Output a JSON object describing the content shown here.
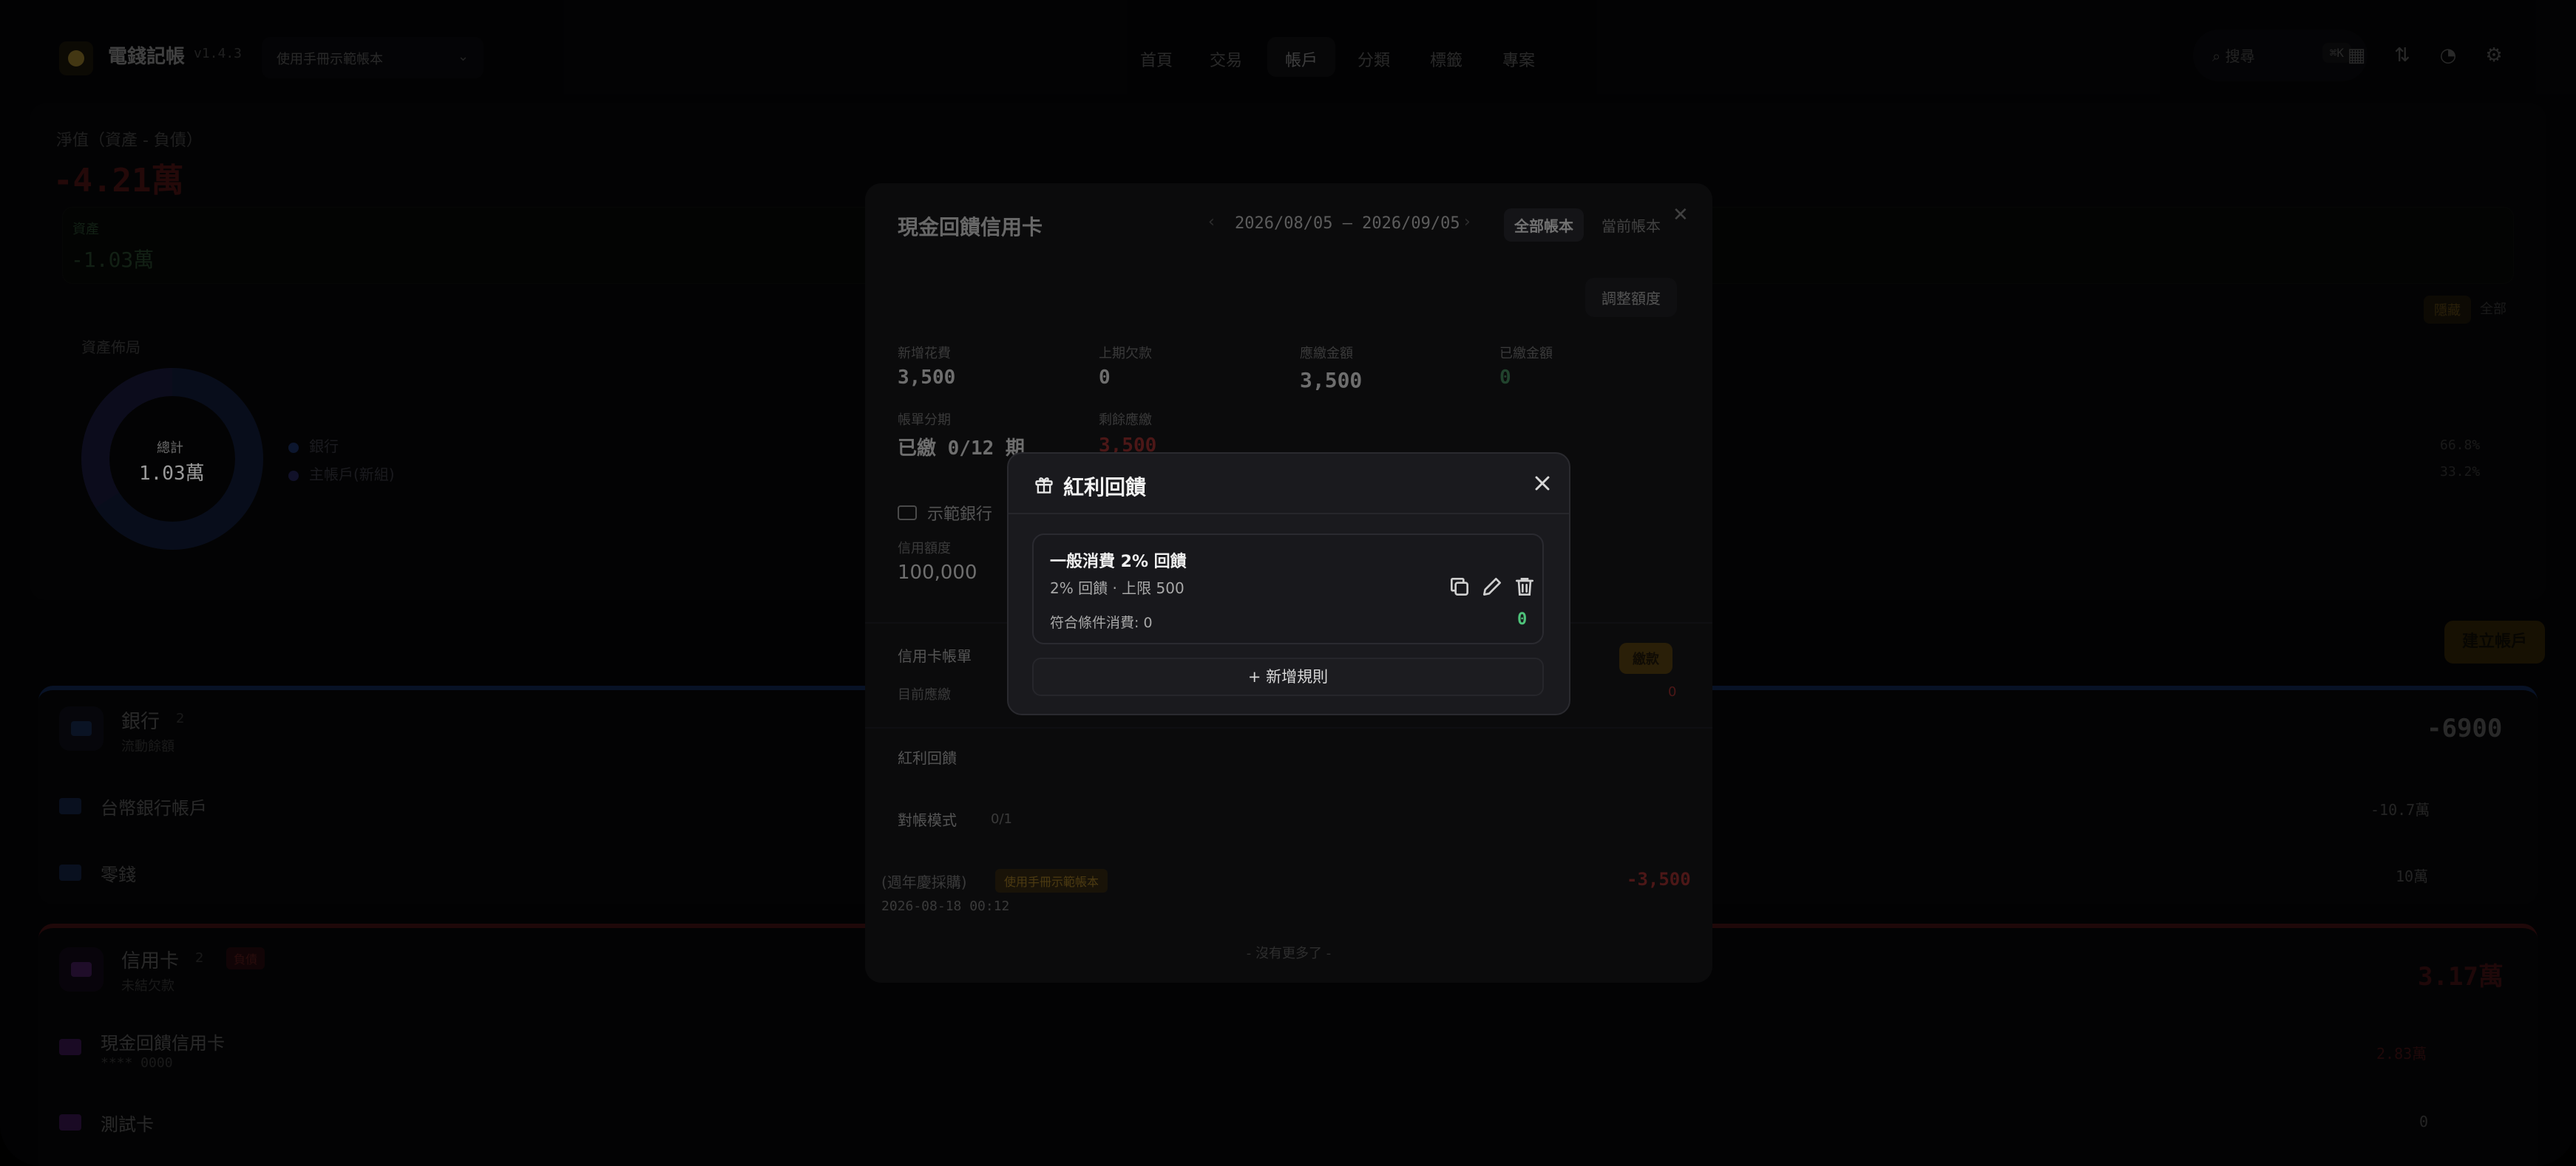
{
  "app": {
    "name": "電錢記帳",
    "version": "v1.4.3",
    "book_selector": "使用手冊示範帳本"
  },
  "nav": {
    "items": [
      {
        "label": "首頁"
      },
      {
        "label": "交易"
      },
      {
        "label": "帳戶"
      },
      {
        "label": "分類"
      },
      {
        "label": "標籤"
      },
      {
        "label": "專案"
      }
    ]
  },
  "toolbar": {
    "search_label": "搜尋",
    "search_shortcut": "⌘K"
  },
  "net_assets": {
    "label": "淨值（資產 - 負債）",
    "value": "-4.21萬",
    "sub_label": "資產",
    "sub_value": "-1.03萬",
    "toggle_on": "隱藏",
    "toggle_off": "全部",
    "distribution_label": "資產佈局",
    "donut_center_label": "總計",
    "donut_center_value": "1.03萬",
    "legend": [
      {
        "name": "銀行",
        "pct": "66.8%",
        "color": "#1d2f5c"
      },
      {
        "name": "主帳戶(新組)",
        "pct": "33.2%",
        "color": "#2a2a60"
      }
    ]
  },
  "create_account_label": "建立帳戶",
  "bank_group": {
    "title": "銀行",
    "count": "2",
    "subtitle": "流動餘額",
    "total": "-6900",
    "accounts": [
      {
        "name": "台幣銀行帳戶",
        "value": "-10.7萬"
      },
      {
        "name": "零錢",
        "value": "10萬"
      }
    ]
  },
  "credit_group": {
    "title": "信用卡",
    "count": "2",
    "badge": "負債",
    "subtitle": "未結欠款",
    "total": "3.17萬",
    "accounts": [
      {
        "name": "現金回饋信用卡",
        "sub": "**** 0000",
        "value": "2.83萬"
      },
      {
        "name": "測試卡",
        "value": "0"
      }
    ]
  },
  "card_modal": {
    "title": "現金回饋信用卡",
    "date_range": "2026/08/05 – 2026/09/05",
    "scope_all": "全部帳本",
    "scope_current": "當前帳本",
    "adjust_label": "調整額度",
    "stats": [
      {
        "label": "新增花費",
        "value": "3,500"
      },
      {
        "label": "上期欠款",
        "value": "0"
      },
      {
        "label": "應繳金額",
        "value": "3,500"
      },
      {
        "label": "已繳金額",
        "value": "0"
      }
    ],
    "stats2": [
      {
        "label": "帳單分期",
        "value": "已繳 0/12 期"
      },
      {
        "label": "剩餘應繳",
        "value": "3,500"
      }
    ],
    "bank_name": "示範銀行",
    "limit_label": "信用額度",
    "limit_value": "100,000",
    "bill_label": "信用卡帳單",
    "pay_label": "繳款",
    "current_due_label": "目前應繳",
    "current_due_value": "0",
    "rebate_label": "紅利回饋",
    "reconcile_label": "對帳模式",
    "reconcile_count": "0/1",
    "txn": {
      "title": "(週年慶採購)",
      "tag": "使用手冊示範帳本",
      "amount": "-3,500",
      "time": "2026-08-18 00:12"
    },
    "no_more": "- 沒有更多了 -"
  },
  "rebate_modal": {
    "title": "紅利回饋",
    "rule": {
      "name": "一般消費 2% 回饋",
      "desc": "2% 回饋 · 上限 500",
      "match_label": "符合條件消費: 0",
      "rebate_value": "0"
    },
    "add_rule_label": "+ 新增規則"
  }
}
